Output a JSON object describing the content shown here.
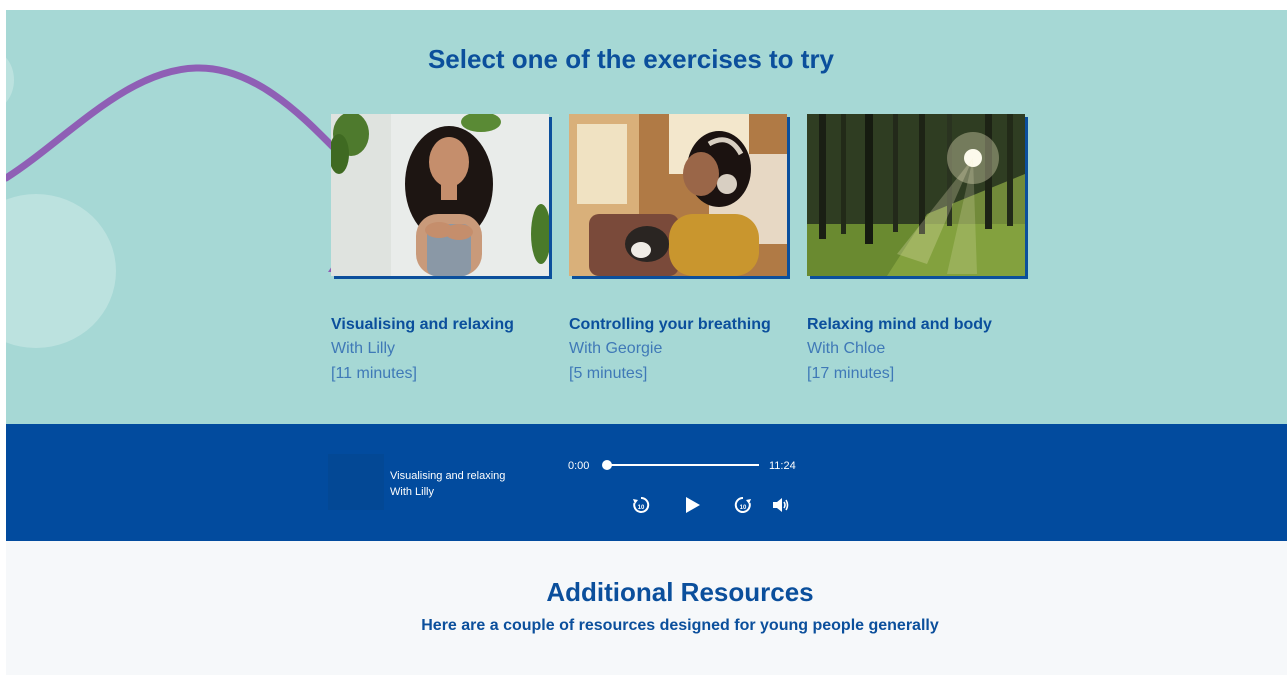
{
  "exercises": {
    "heading": "Select one of the exercises to try",
    "cards": [
      {
        "title": "Visualising and relaxing",
        "with": "With Lilly",
        "duration": "[11 minutes]"
      },
      {
        "title": "Controlling your breathing",
        "with": "With Georgie",
        "duration": "[5 minutes]"
      },
      {
        "title": "Relaxing mind and body",
        "with": "With Chloe",
        "duration": "[17 minutes]"
      }
    ]
  },
  "player": {
    "track_title": "Visualising and relaxing",
    "track_artist": "With Lilly",
    "current_time": "0:00",
    "total_time": "11:24",
    "progress_fraction": 0,
    "controls": [
      "rewind-10-icon",
      "play-icon",
      "forward-10-icon",
      "volume-icon"
    ]
  },
  "resources": {
    "heading": "Additional Resources",
    "subheading": "Here are a couple of resources designed for young people generally"
  },
  "colors": {
    "teal_bg": "#a6d8d5",
    "brand_blue": "#0b4f9c",
    "player_bg": "#024b9e",
    "wave": "#8f5fb5",
    "resources_bg": "#f6f8fa"
  }
}
